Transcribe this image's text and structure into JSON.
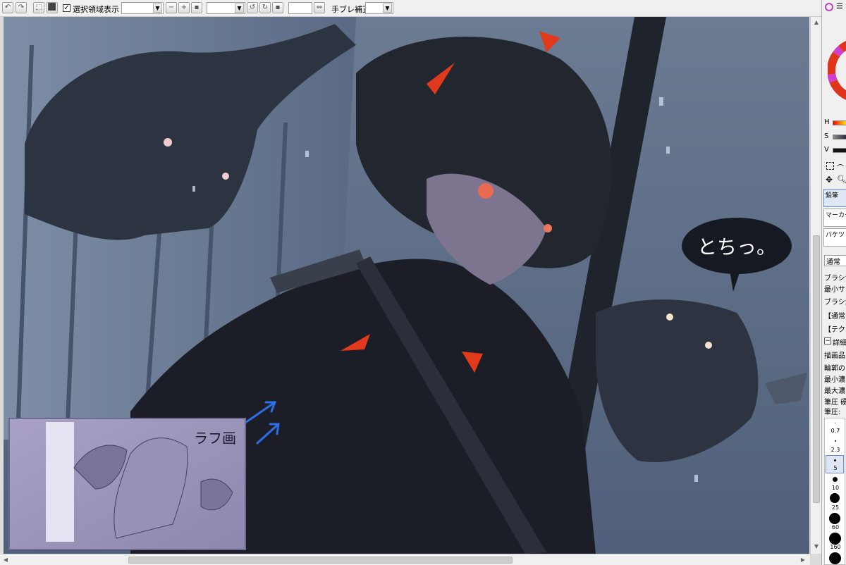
{
  "toolbar": {
    "selection_checkbox_label": "選択領域表示",
    "selection_checked": true,
    "stabilizer_label": "手ブレ補正",
    "zoom_value": "",
    "angle_value": "",
    "stabilizer_value": ""
  },
  "speech_bubble": {
    "text": "とちっ。"
  },
  "sketch_thumbnail": {
    "label": "ラフ画"
  },
  "side_panel": {
    "hsv_labels": [
      "H",
      "S",
      "V"
    ],
    "tools": [
      "鉛筆",
      "マーカー",
      "バケツ"
    ],
    "blend_mode": "通常",
    "props": [
      "ブラシサイ",
      "最小サイ",
      "ブラシ濃",
      "【通常の",
      "【テクス",
      "詳細",
      "描画品",
      "輪郭の",
      "最小濃",
      "最大濃",
      "筆圧 硬",
      "筆圧:"
    ],
    "brush_sizes": [
      "0.7",
      "2.3",
      "5",
      "10",
      "25",
      "60",
      "160"
    ]
  },
  "colors": {
    "canvas_bg": "#3a4250",
    "panel_bg": "#f0f0f0",
    "accent_red": "#e0391c",
    "arrow_blue": "#2d6ee6"
  }
}
